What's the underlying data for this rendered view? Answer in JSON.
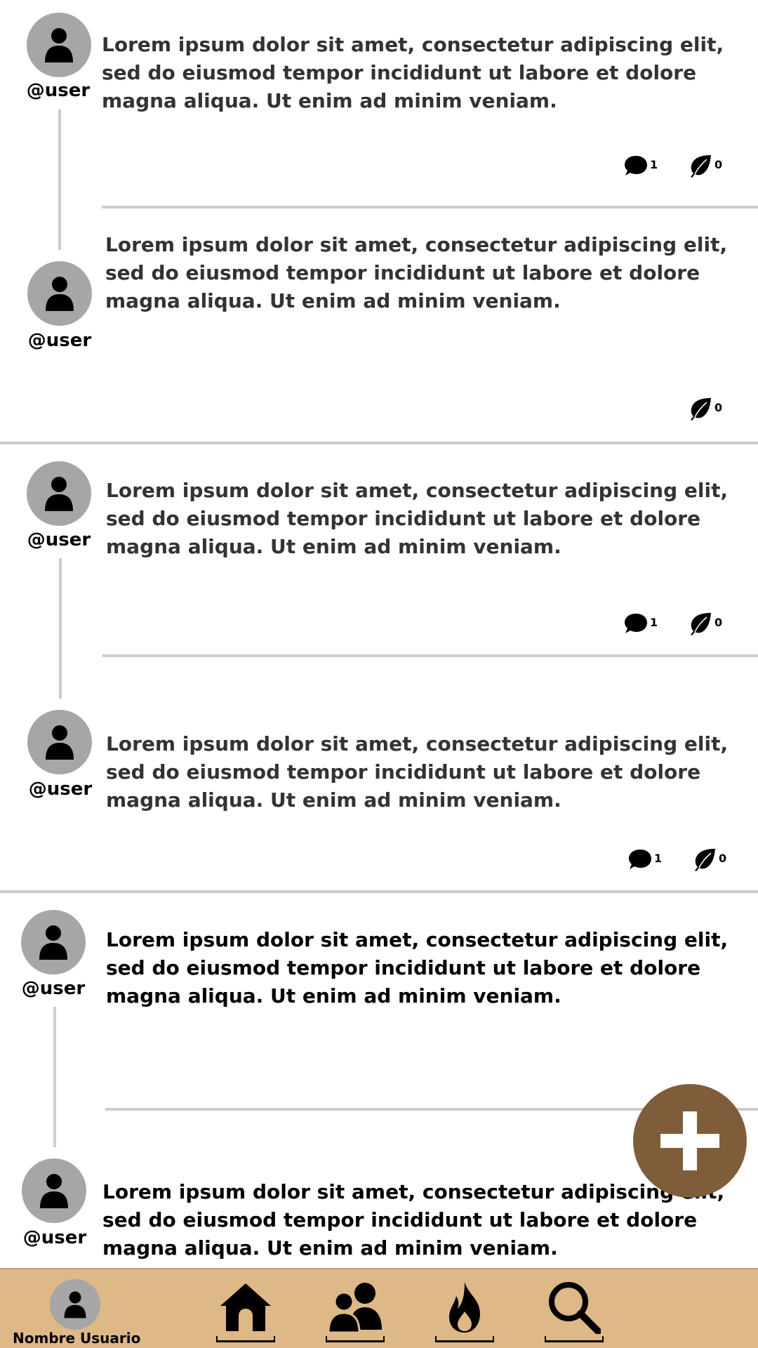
{
  "colors": {
    "avatar_bg": "#a6a6a6",
    "divider": "#cccccc",
    "fab_bg": "#7f5d3a",
    "nav_bg": "#deb887"
  },
  "posts": [
    {
      "username": "@user",
      "text": "Lorem ipsum dolor sit amet, consectetur adipiscing elit, sed do eiusmod tempor incididunt ut labore et dolore magna aliqua. Ut enim ad minim veniam.",
      "comments": "1",
      "likes": "0"
    },
    {
      "username": "@user",
      "text": "Lorem ipsum dolor sit amet, consectetur adipiscing elit, sed do eiusmod tempor incididunt ut labore et dolore magna aliqua. Ut enim ad minim veniam.",
      "likes": "0"
    },
    {
      "username": "@user",
      "text": "Lorem ipsum dolor sit amet, consectetur adipiscing elit, sed do eiusmod tempor incididunt ut labore et dolore magna aliqua. Ut enim ad minim veniam.",
      "comments": "1",
      "likes": "0"
    },
    {
      "username": "@user",
      "text": "Lorem ipsum dolor sit amet, consectetur adipiscing elit, sed do eiusmod tempor incididunt ut labore et dolore magna aliqua. Ut enim ad minim veniam.",
      "comments": "1",
      "likes": "0"
    },
    {
      "username": "@user",
      "text": "Lorem ipsum dolor sit amet, consectetur adipiscing elit, sed do eiusmod tempor incididunt ut labore et dolore magna aliqua. Ut enim ad minim veniam."
    },
    {
      "username": "@user",
      "text": "Lorem ipsum dolor sit amet, consectetur adipiscing elit, sed do eiusmod tempor incididunt ut labore et dolore magna aliqua. Ut enim ad minim veniam."
    }
  ],
  "fab": {
    "icon": "plus-icon"
  },
  "nav": {
    "profile_name": "Nombre  Usuario",
    "items": [
      {
        "icon": "home-icon"
      },
      {
        "icon": "users-icon"
      },
      {
        "icon": "fire-icon"
      },
      {
        "icon": "search-icon"
      }
    ]
  }
}
